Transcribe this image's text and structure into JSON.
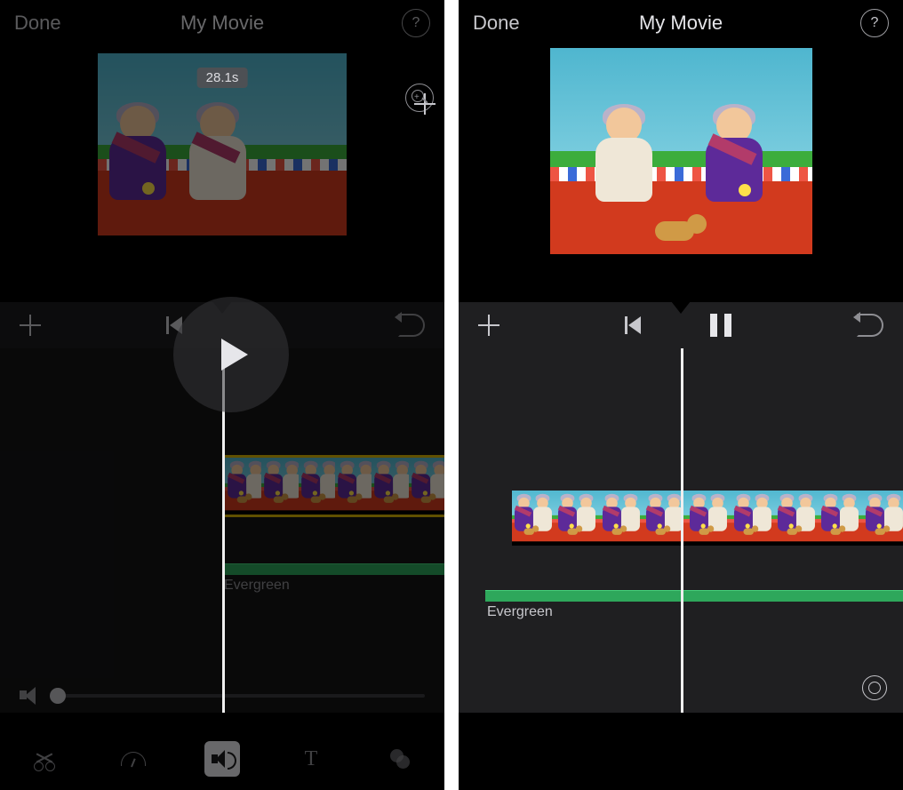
{
  "left": {
    "header": {
      "done": "Done",
      "title": "My Movie"
    },
    "clip_duration": "28.1s",
    "audio_label": "Evergreen"
  },
  "right": {
    "header": {
      "done": "Done",
      "title": "My Movie"
    },
    "audio_label": "Evergreen"
  },
  "thumb_count_left": 6,
  "thumb_count_right": 9
}
